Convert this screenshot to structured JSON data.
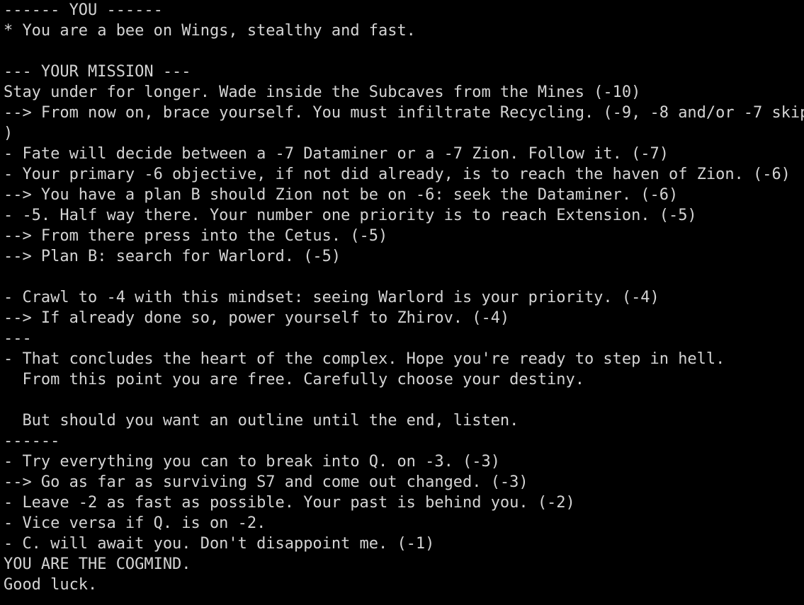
{
  "terminal": {
    "text_color": "#d4d4d4",
    "background": "#000000",
    "lines": [
      "------ YOU ------",
      "* You are a bee on Wings, stealthy and fast.",
      "",
      "--- YOUR MISSION ---",
      "Stay under for longer. Wade inside the Subcaves from the Mines (-10)",
      "--> From now on, brace yourself. You must infiltrate Recycling. (-9, -8 and/or -7 skip",
      ")",
      "- Fate will decide between a -7 Dataminer or a -7 Zion. Follow it. (-7)",
      "- Your primary -6 objective, if not did already, is to reach the haven of Zion. (-6)",
      "--> You have a plan B should Zion not be on -6: seek the Dataminer. (-6)",
      "- -5. Half way there. Your number one priority is to reach Extension. (-5)",
      "--> From there press into the Cetus. (-5)",
      "--> Plan B: search for Warlord. (-5)",
      "",
      "- Crawl to -4 with this mindset: seeing Warlord is your priority. (-4)",
      "--> If already done so, power yourself to Zhirov. (-4)",
      "---",
      "- That concludes the heart of the complex. Hope you're ready to step in hell.",
      "  From this point you are free. Carefully choose your destiny.",
      "",
      "  But should you want an outline until the end, listen.",
      "------",
      "- Try everything you can to break into Q. on -3. (-3)",
      "--> Go as far as surviving S7 and come out changed. (-3)",
      "- Leave -2 as fast as possible. Your past is behind you. (-2)",
      "- Vice versa if Q. is on -2.",
      "- C. will await you. Don't disappoint me. (-1)",
      "YOU ARE THE COGMIND.",
      "Good luck."
    ]
  }
}
